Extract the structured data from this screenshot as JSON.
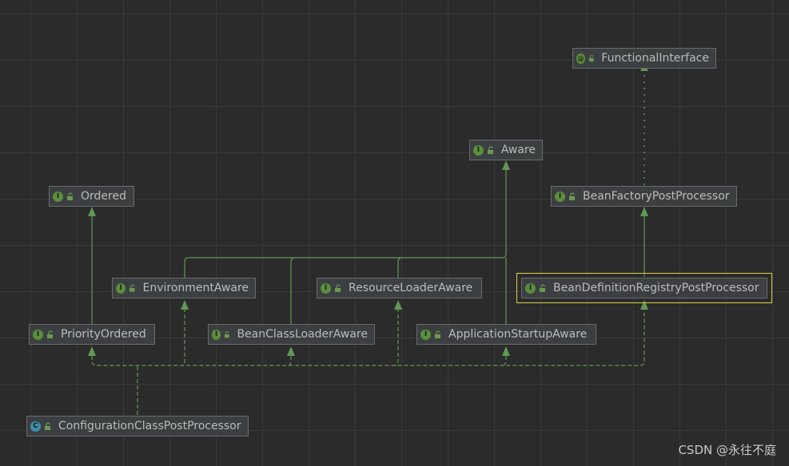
{
  "nodes": {
    "functional_interface": {
      "label": "FunctionalInterface",
      "kind": "@"
    },
    "aware": {
      "label": "Aware",
      "kind": "I"
    },
    "ordered": {
      "label": "Ordered",
      "kind": "I"
    },
    "bean_factory_post_processor": {
      "label": "BeanFactoryPostProcessor",
      "kind": "I"
    },
    "environment_aware": {
      "label": "EnvironmentAware",
      "kind": "I"
    },
    "resource_loader_aware": {
      "label": "ResourceLoaderAware",
      "kind": "I"
    },
    "bean_definition_registry_post_processor": {
      "label": "BeanDefinitionRegistryPostProcessor",
      "kind": "I"
    },
    "priority_ordered": {
      "label": "PriorityOrdered",
      "kind": "I"
    },
    "bean_class_loader_aware": {
      "label": "BeanClassLoaderAware",
      "kind": "I"
    },
    "application_startup_aware": {
      "label": "ApplicationStartupAware",
      "kind": "I"
    },
    "configuration_class_post_processor": {
      "label": "ConfigurationClassPostProcessor",
      "kind": "C"
    }
  },
  "colors": {
    "edge_extends": "#629755",
    "edge_implements": "#629755",
    "edge_annotation": "#629755",
    "selection": "#e0d34a",
    "interface_badge": "#5b8e3c",
    "class_badge": "#3b8fa8"
  },
  "watermark": "CSDN @永往不庭"
}
